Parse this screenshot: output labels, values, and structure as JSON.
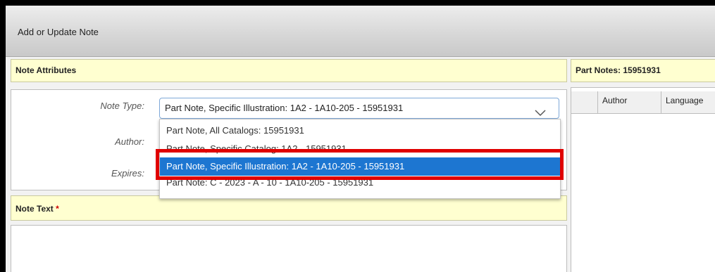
{
  "window": {
    "title": "Add or Update Note"
  },
  "attributes": {
    "header": "Note Attributes",
    "note_type_label": "Note Type:",
    "author_label": "Author:",
    "expires_label": "Expires:",
    "note_type_value": "Part Note, Specific Illustration: 1A2 - 1A10-205 - 15951931"
  },
  "dropdown": {
    "options": [
      "Part Note, All Catalogs: 15951931",
      "Part Note, Specific Catalog: 1A2 - 15951931",
      "Part Note, Specific Illustration: 1A2 - 1A10-205 - 15951931",
      "Part Note: C - 2023 - A - 10 - 1A10-205 - 15951931"
    ],
    "selected_index": 2
  },
  "note_text": {
    "header": "Note Text",
    "required_mark": "*"
  },
  "part_notes": {
    "header": "Part Notes: 15951931",
    "columns": [
      "Author",
      "Language"
    ]
  },
  "colors": {
    "accent": "#1d76d1",
    "highlight": "#e00000",
    "header_bg": "#ffffd0"
  }
}
